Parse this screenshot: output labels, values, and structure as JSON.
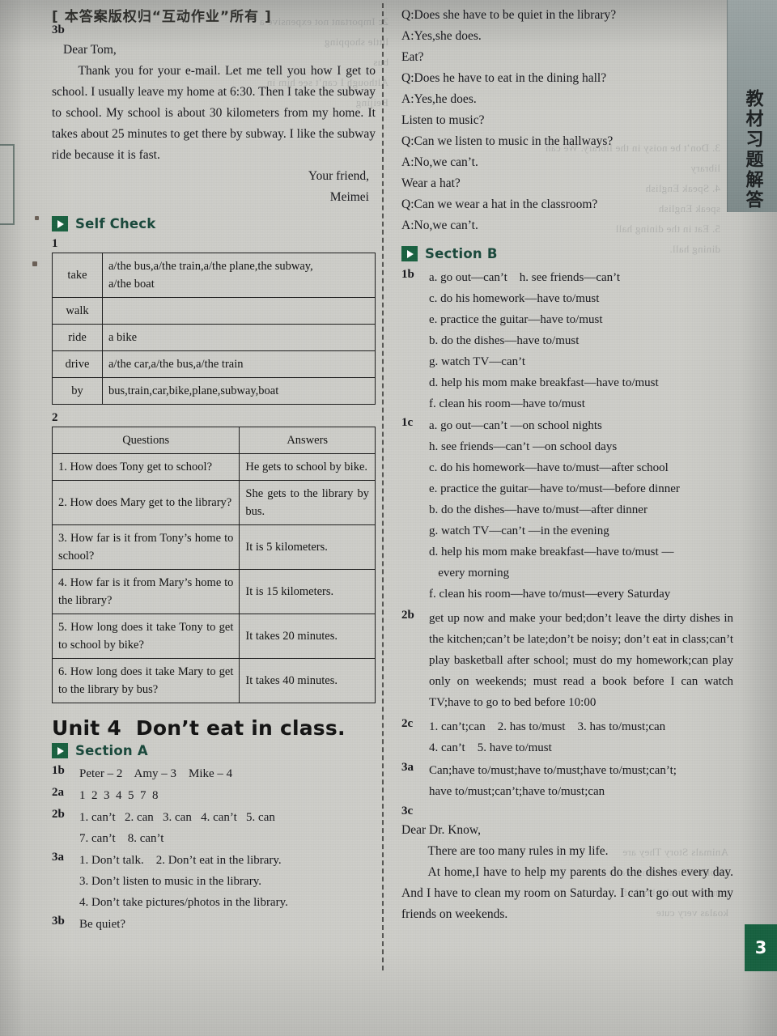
{
  "page": {
    "copyright_watermark": "[ 本答案版权归“互动作业”所有  ]",
    "side_tab_text": "教材习题解答",
    "page_number": "3"
  },
  "left_column": {
    "letter_3b": {
      "label": "3b",
      "salutation": "Dear Tom,",
      "body": "Thank you for your e-mail. Let me tell you how I get to school. I usually leave my home at 6:30. Then I take the subway to school. My school is about 30 kilometers from my home. It takes about 25 minutes to get there by subway. I like the subway ride because it is fast.",
      "closing": "Your friend,",
      "signature": "Meimei"
    },
    "self_check": {
      "title": "Self Check",
      "icon": "play-arrow-icon"
    },
    "exercise_1": {
      "label": "1",
      "rows": [
        {
          "verb": "take",
          "value": "a/the bus,a/the train,a/the plane,the subway,\na/the boat"
        },
        {
          "verb": "walk",
          "value": ""
        },
        {
          "verb": "ride",
          "value": "a bike"
        },
        {
          "verb": "drive",
          "value": "a/the car,a/the bus,a/the train"
        },
        {
          "verb": "by",
          "value": "bus,train,car,bike,plane,subway,boat"
        }
      ]
    },
    "exercise_2": {
      "label": "2",
      "headers": [
        "Questions",
        "Answers"
      ],
      "rows": [
        {
          "question": "1. How does Tony get to school?",
          "answer": "He gets to school by bike."
        },
        {
          "question": "2. How does Mary get to the library?",
          "answer": "She gets to the library by bus."
        },
        {
          "question": "3. How far is it from Tony’s home to school?",
          "answer": "It is 5 kilometers."
        },
        {
          "question": "4. How far is it from Mary’s home to the library?",
          "answer": "It is 15 kilometers."
        },
        {
          "question": "5. How long does it take Tony to get to school by bike?",
          "answer": "It takes 20 minutes."
        },
        {
          "question": "6. How long does it take Mary to get to the library by bus?",
          "answer": "It takes 40 minutes."
        }
      ]
    },
    "unit": {
      "number": "Unit 4",
      "title": "Don’t eat in class."
    },
    "section_a": {
      "title": "Section A",
      "icon": "play-arrow-icon",
      "items": [
        {
          "label": "1b",
          "lines": [
            "Peter – 2    Amy – 3    Mike – 4"
          ]
        },
        {
          "label": "2a",
          "lines": [
            "1  2  3  4  5  7  8"
          ]
        },
        {
          "label": "2b",
          "lines": [
            "1. can’t   2. can   3. can   4. can’t   5. can",
            "7. can’t    8. can’t"
          ]
        },
        {
          "label": "3a",
          "lines": [
            "1. Don’t talk.    2. Don’t eat in the library.",
            "3. Don’t listen to music in the library.",
            "4. Don’t take pictures/photos in the library."
          ]
        },
        {
          "label": "3b",
          "lines": [
            "Be quiet?"
          ]
        }
      ]
    }
  },
  "right_column": {
    "qa_top": [
      "Q:Does she have to be quiet in the library?",
      "A:Yes,she does.",
      "Eat?",
      "Q:Does he have to eat in the dining hall?",
      "A:Yes,he does.",
      "Listen to music?",
      "Q:Can we listen to music in the hallways?",
      "A:No,we can’t.",
      "Wear a hat?",
      "Q:Can we wear a hat in the classroom?",
      "A:No,we can’t."
    ],
    "section_b": {
      "title": "Section B",
      "icon": "play-arrow-icon",
      "items": [
        {
          "label": "1b",
          "lines": [
            "a. go out—can’t    h. see friends—can’t",
            "c. do his homework—have to/must",
            "e. practice the guitar—have to/must",
            "b. do the dishes—have to/must",
            "g. watch TV—can’t",
            "d. help his mom make breakfast—have to/must",
            "f. clean his room—have to/must"
          ]
        },
        {
          "label": "1c",
          "lines": [
            "a. go out—can’t —on school nights",
            "h. see friends—can’t —on school days",
            "c. do his homework—have to/must—after school",
            "e. practice the guitar—have to/must—before dinner",
            "b. do the dishes—have to/must—after dinner",
            "g. watch TV—can’t —in the evening",
            "d. help his mom make breakfast—have to/must —",
            "   every morning",
            "f. clean his room—have to/must—every Saturday"
          ]
        }
      ],
      "item_2b": {
        "label": "2b",
        "text": "get up now and make your bed;don’t leave the dirty dishes in the kitchen;can’t be late;don’t be noisy; don’t eat in class;can’t play basketball after school; must do my homework;can play only on weekends; must read a book before I can watch TV;have to go to bed before 10:00"
      },
      "item_2c": {
        "label": "2c",
        "lines": [
          "1. can’t;can    2. has to/must    3. has to/must;can",
          "4. can’t    5. have to/must"
        ]
      },
      "item_3a": {
        "label": "3a",
        "lines": [
          "Can;have to/must;have to/must;have to/must;can’t;",
          "have to/must;can’t;have to/must;can"
        ]
      },
      "item_3c": {
        "label": "3c",
        "salutation": "Dear Dr. Know,",
        "para1": "There are too many rules in my life.",
        "para2": "At home,I have to help my parents do the dishes every day. And I have to clean my room on Saturday. I can’t go out with my friends on weekends."
      }
    }
  }
}
